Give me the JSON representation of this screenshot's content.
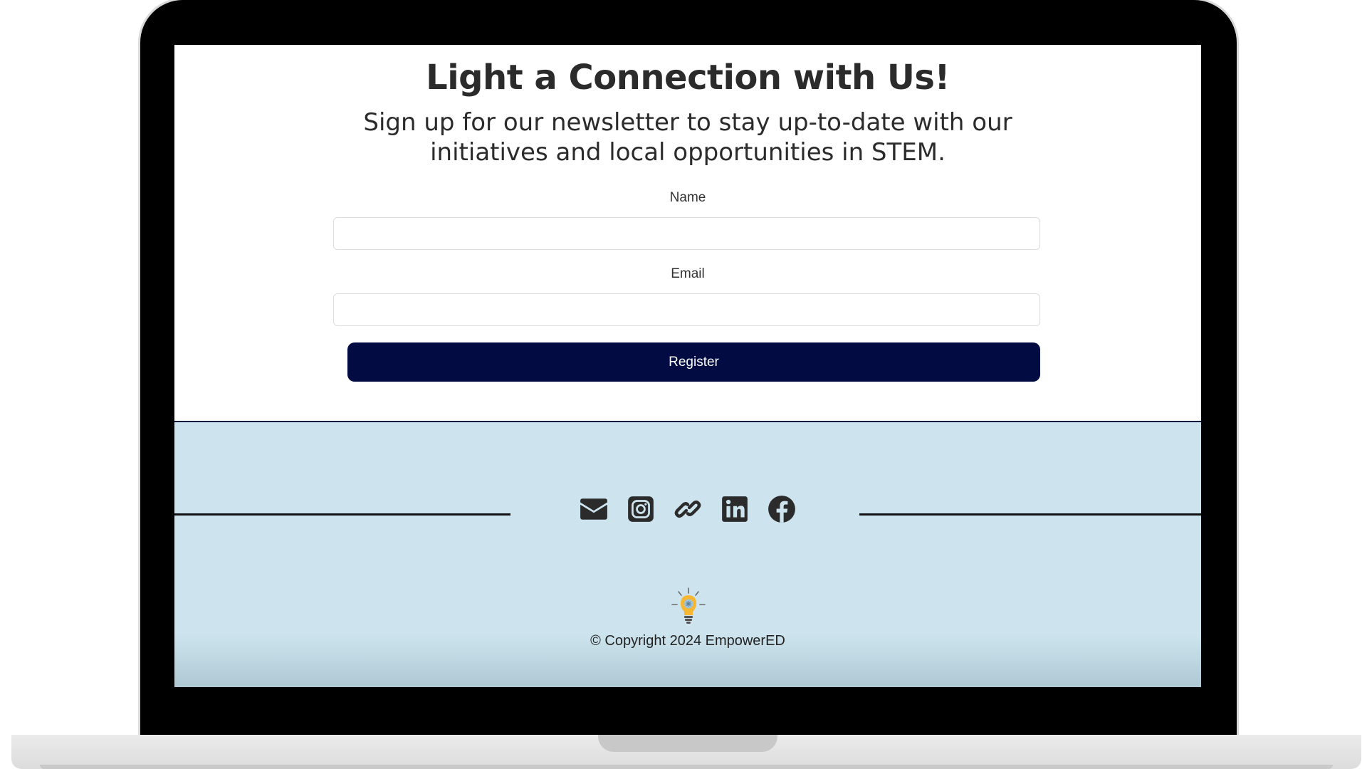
{
  "signup": {
    "headline": "Light a Connection with Us!",
    "subheadline": "Sign up for our newsletter to stay up-to-date with our initiatives and local opportunities in STEM.",
    "name_label": "Name",
    "name_value": "",
    "email_label": "Email",
    "email_value": "",
    "register_label": "Register"
  },
  "footer": {
    "social_icons": [
      "envelope-icon",
      "instagram-icon",
      "link-icon",
      "linkedin-icon",
      "facebook-icon"
    ],
    "logo_icon": "lightbulb-logo-icon",
    "copyright": "© Copyright 2024 EmpowerED"
  },
  "colors": {
    "button": "#020b42",
    "footer_background": "#cde4ee",
    "text": "#2b2b2b"
  }
}
